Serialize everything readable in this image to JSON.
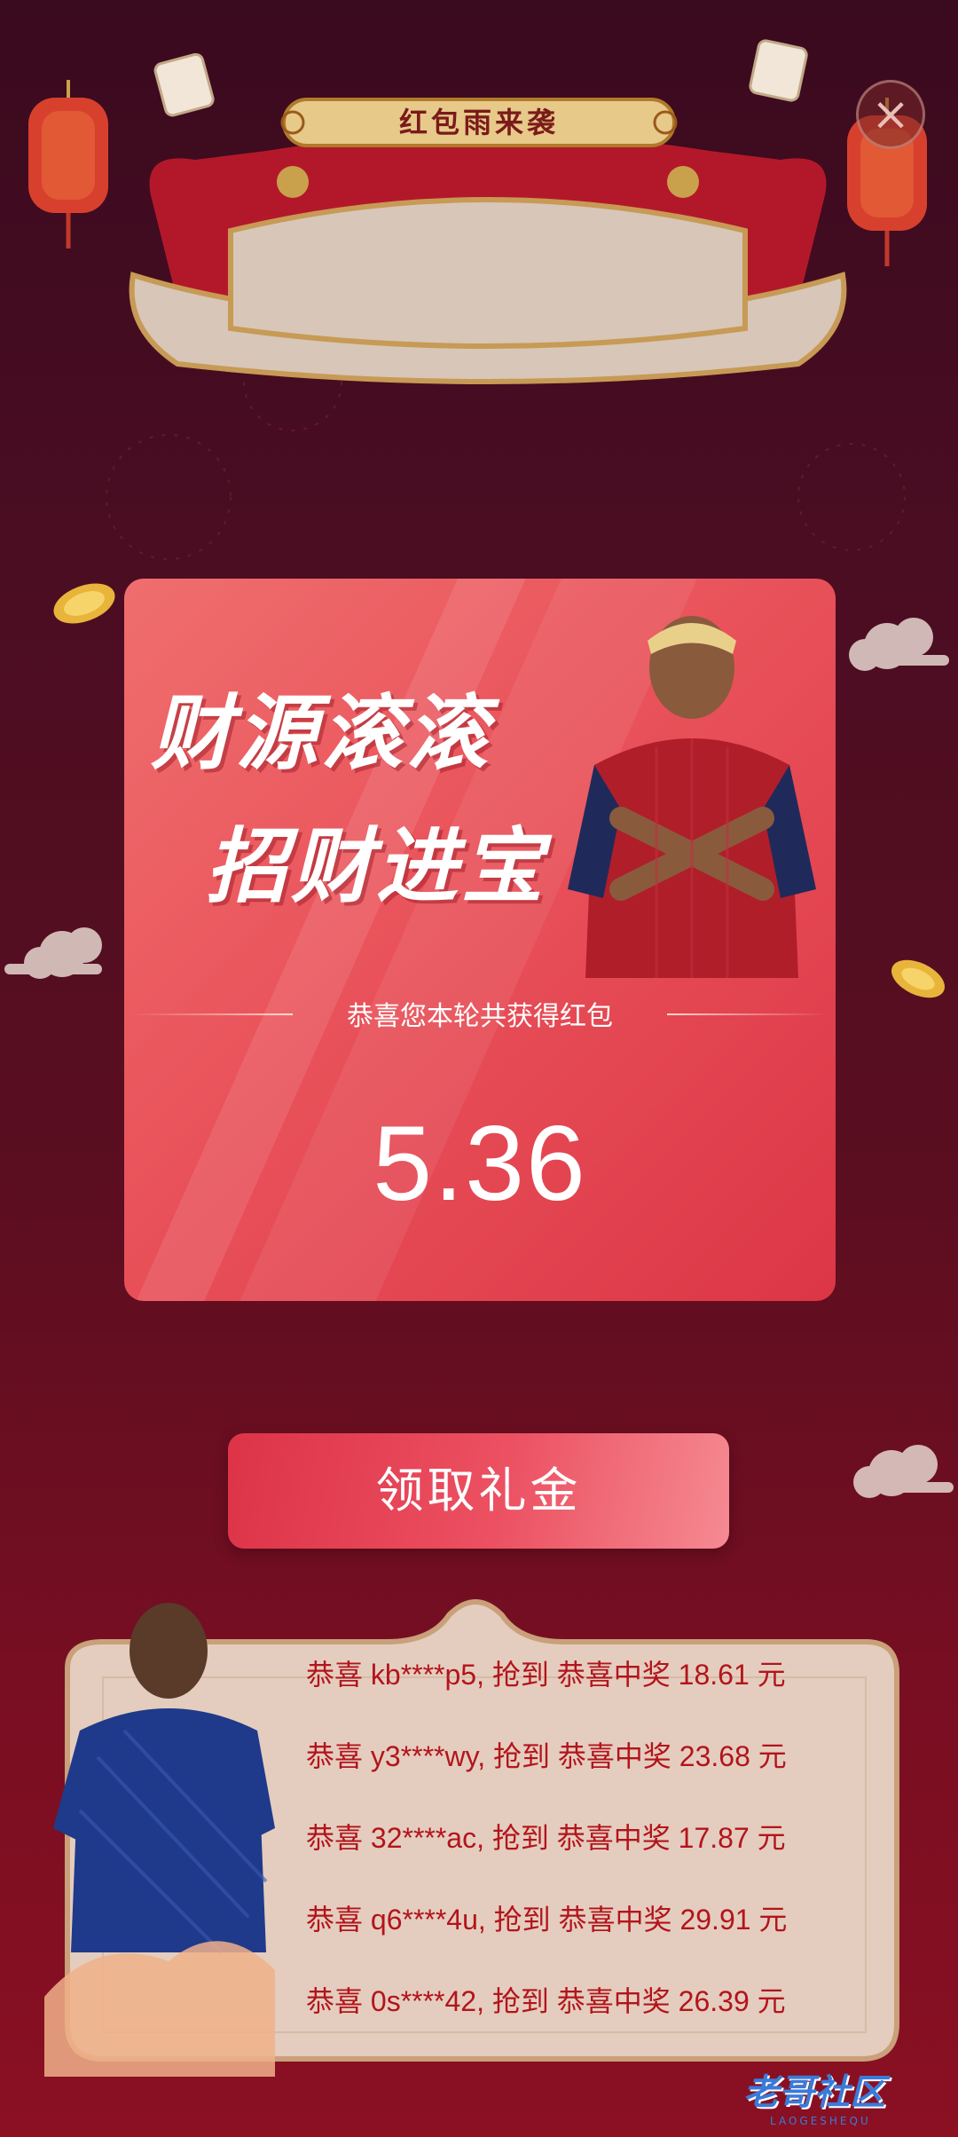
{
  "header": {
    "title": "红包雨来袭",
    "close_icon": "close-icon"
  },
  "card": {
    "slogan_line1": "财源滚滚",
    "slogan_line2": "招财进宝",
    "congrats_text": "恭喜您本轮共获得红包",
    "amount": "5.36"
  },
  "claim_button": {
    "label": "领取礼金"
  },
  "winners": [
    {
      "text": "恭喜 kb****p5, 抢到 恭喜中奖 18.61 元"
    },
    {
      "text": "恭喜 y3****wy, 抢到 恭喜中奖 23.68 元"
    },
    {
      "text": "恭喜 32****ac, 抢到 恭喜中奖 17.87 元"
    },
    {
      "text": "恭喜 q6****4u, 抢到 恭喜中奖 29.91 元"
    },
    {
      "text": "恭喜 0s****42, 抢到 恭喜中奖 26.39 元"
    }
  ],
  "watermark": {
    "text": "老哥社区",
    "subtext": "LAOGESHEQU"
  },
  "colors": {
    "accent": "#e2394b",
    "winner_text": "#b3141c",
    "background": "#4a0d22"
  }
}
